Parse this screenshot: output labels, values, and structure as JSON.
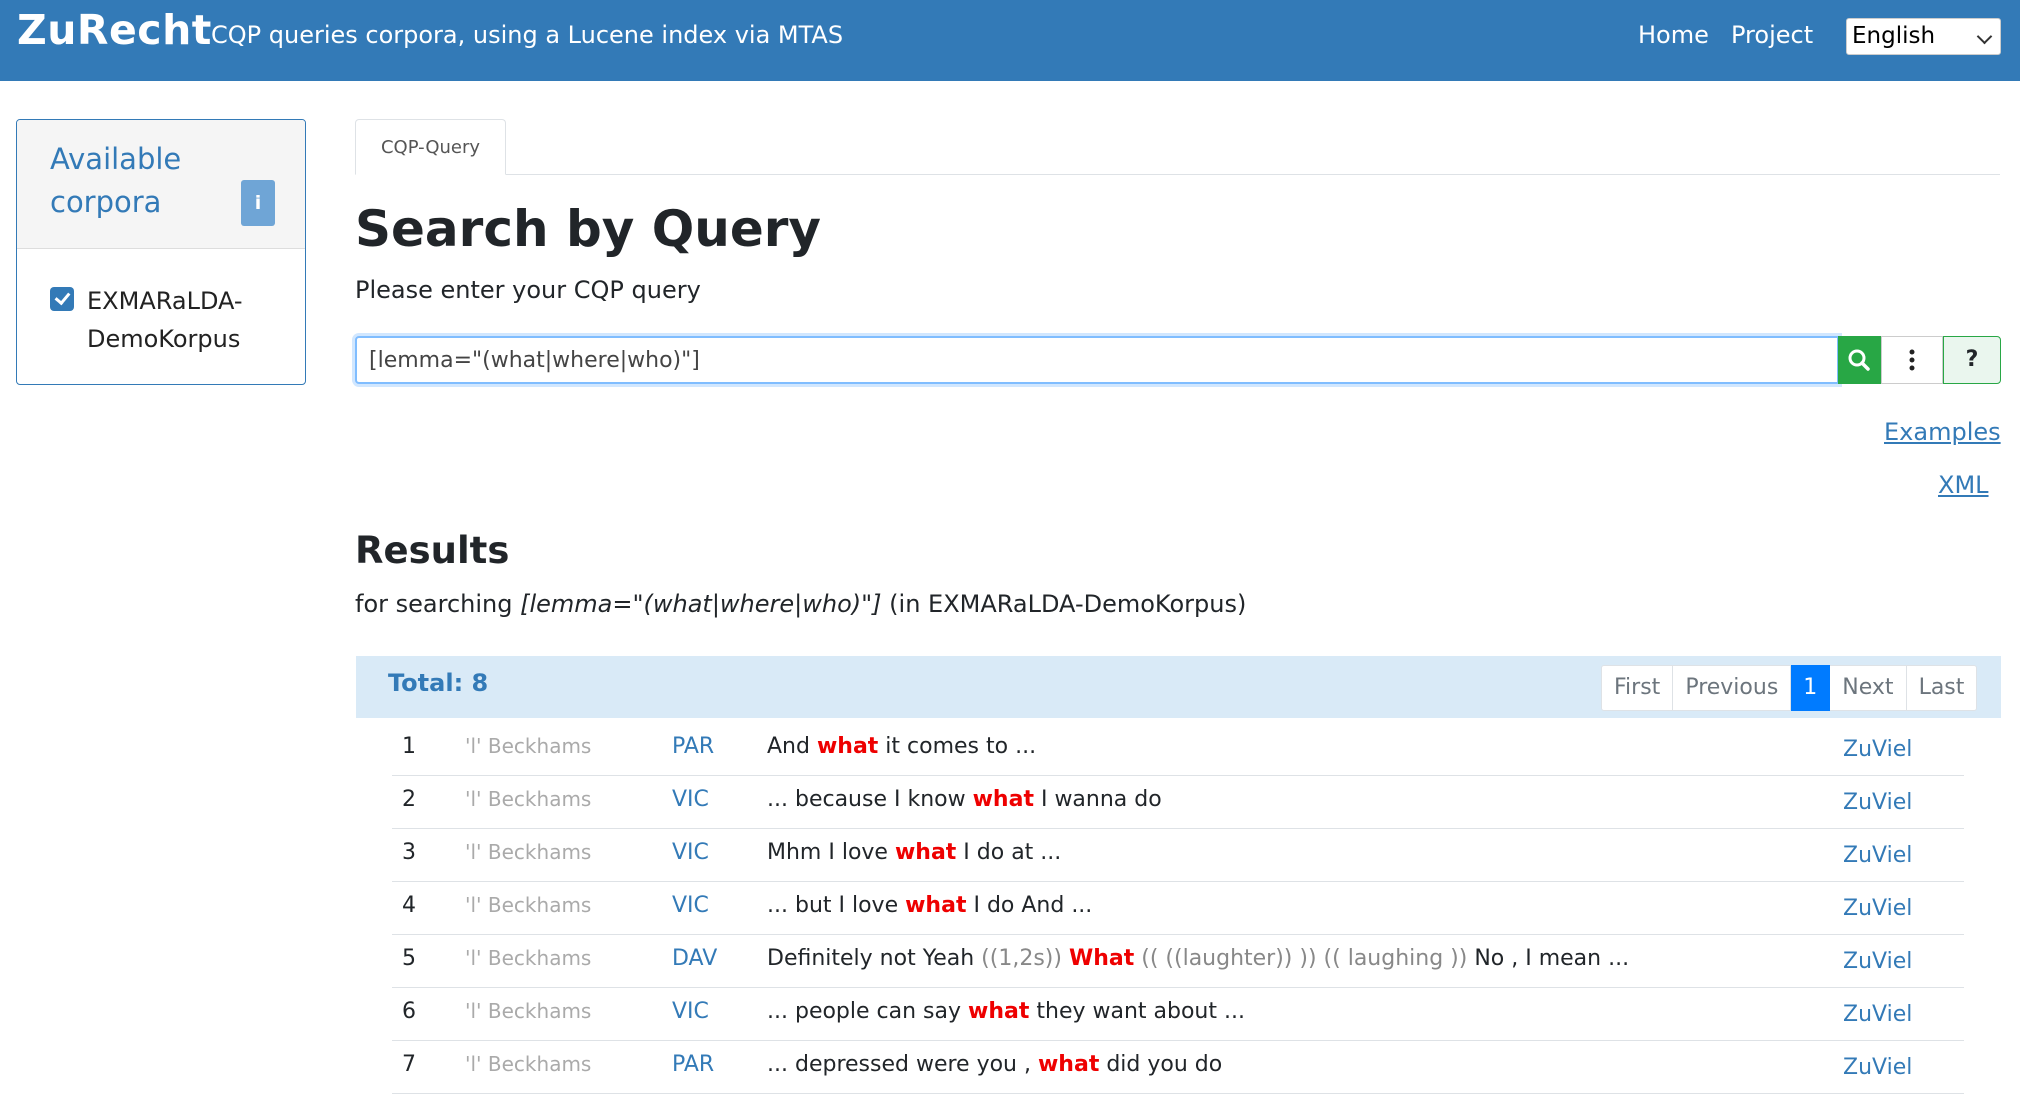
{
  "navbar": {
    "brand": "ZuRecht",
    "tagline": "CQP queries corpora, using a Lucene index via MTAS",
    "home": "Home",
    "project": "Project",
    "language": "English"
  },
  "sidebar": {
    "title": "Available corpora",
    "info_label": "i",
    "corpus_label": "EXMARaLDA-DemoKorpus"
  },
  "main": {
    "tab_label": "CQP-Query",
    "heading": "Search by Query",
    "subheading": "Please enter your CQP query",
    "query_value": "[lemma=\"(what|where|who)\"]",
    "help_label": "?",
    "examples_label": "Examples",
    "xml_label": "XML",
    "results_heading": "Results",
    "results_for_prefix": "for searching ",
    "results_for_query": "[lemma=\"(what|where|who)\"]",
    "results_for_suffix": " (in EXMARaLDA-DemoKorpus)",
    "total_label": "Total: 8",
    "pager": [
      "First",
      "Previous",
      "1",
      "Next",
      "Last"
    ]
  },
  "results": [
    {
      "num": "1",
      "speaker": "'l' Beckhams",
      "code": "PAR",
      "before": "And ",
      "hit": "what",
      "after": " it comes to ...",
      "link": "ZuViel"
    },
    {
      "num": "2",
      "speaker": "'l' Beckhams",
      "code": "VIC",
      "before": "... because I know ",
      "hit": "what",
      "after": " I wanna do",
      "link": "ZuViel"
    },
    {
      "num": "3",
      "speaker": "'l' Beckhams",
      "code": "VIC",
      "before": "Mhm I love ",
      "hit": "what",
      "after": " I do at ...",
      "link": "ZuViel"
    },
    {
      "num": "4",
      "speaker": "'l' Beckhams",
      "code": "VIC",
      "before": "... but I love ",
      "hit": "what",
      "after": " I do And ...",
      "link": "ZuViel"
    },
    {
      "num": "5",
      "speaker": "'l' Beckhams",
      "code": "DAV",
      "before": "Definitely not Yeah ",
      "pause1": "((1,2s))",
      "hit": "What",
      "pause2": "(( ((laughter)) )) (( laughing ))",
      "after": " No , I mean ...",
      "link": "ZuViel"
    },
    {
      "num": "6",
      "speaker": "'l' Beckhams",
      "code": "VIC",
      "before": "... people can say ",
      "hit": "what",
      "after": " they want about ...",
      "link": "ZuViel"
    },
    {
      "num": "7",
      "speaker": "'l' Beckhams",
      "code": "PAR",
      "before": "... depressed were you , ",
      "hit": "what",
      "after": " did you do",
      "link": "ZuViel"
    }
  ]
}
